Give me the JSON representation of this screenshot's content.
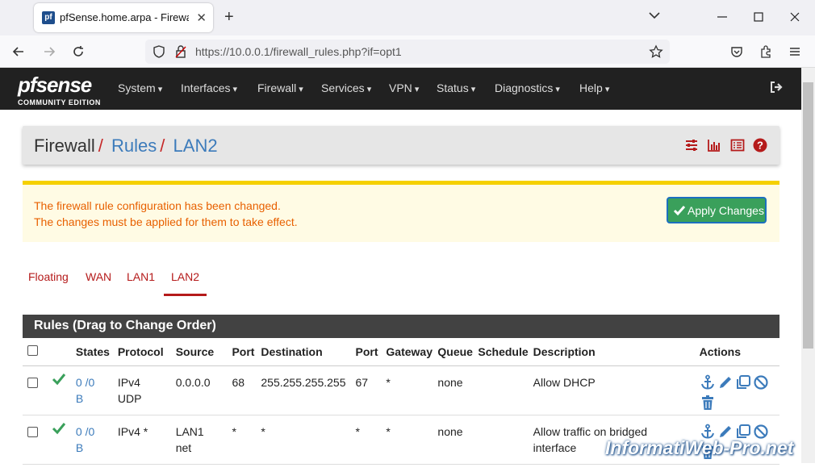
{
  "browser": {
    "tab_title": "pfSense.home.arpa - Firewall: R",
    "favicon_letter": "pf",
    "new_tab": "+",
    "url": "https://10.0.0.1/firewall_rules.php?if=opt1",
    "url_host": "10.0.0.1",
    "url_path": "/firewall_rules.php?if=opt1"
  },
  "header": {
    "logo": "sense",
    "logo_prefix": "pf",
    "edition": "COMMUNITY EDITION",
    "menu": [
      "System",
      "Interfaces",
      "Firewall",
      "Services",
      "VPN",
      "Status",
      "Diagnostics",
      "Help"
    ]
  },
  "breadcrumb": {
    "first": "Firewall",
    "second": "Rules",
    "third": "LAN2",
    "sep": "/"
  },
  "alert": {
    "line1": "The firewall rule configuration has been changed.",
    "line2": "The changes must be applied for them to take effect.",
    "button": "Apply Changes"
  },
  "tabs": [
    {
      "label": "Floating",
      "active": false
    },
    {
      "label": "WAN",
      "active": false
    },
    {
      "label": "LAN1",
      "active": false
    },
    {
      "label": "LAN2",
      "active": true
    }
  ],
  "rules": {
    "title": "Rules (Drag to Change Order)",
    "columns": [
      "States",
      "Protocol",
      "Source",
      "Port",
      "Destination",
      "Port",
      "Gateway",
      "Queue",
      "Schedule",
      "Description",
      "Actions"
    ],
    "rows": [
      {
        "states_a": "0 /0",
        "states_b": "B",
        "protocol_a": "IPv4",
        "protocol_b": "UDP",
        "source_a": "0.0.0.0",
        "source_b": "",
        "sport": "68",
        "destination": "255.255.255.255",
        "dport": "67",
        "gateway": "*",
        "queue": "none",
        "schedule": "",
        "desc_a": "Allow DHCP",
        "desc_b": ""
      },
      {
        "states_a": "0 /0",
        "states_b": "B",
        "protocol_a": "IPv4 *",
        "protocol_b": "",
        "source_a": "LAN1",
        "source_b": "net",
        "sport": "*",
        "destination": "*",
        "dport": "*",
        "gateway": "*",
        "queue": "none",
        "schedule": "",
        "desc_a": "Allow traffic on bridged",
        "desc_b": "interface"
      }
    ]
  },
  "watermark": "InformatiWeb-Pro.net",
  "colors": {
    "header_bg": "#212121",
    "accent_red": "#b51b1b",
    "link_blue": "#3c7bbb",
    "apply_green": "#3aa05b"
  }
}
